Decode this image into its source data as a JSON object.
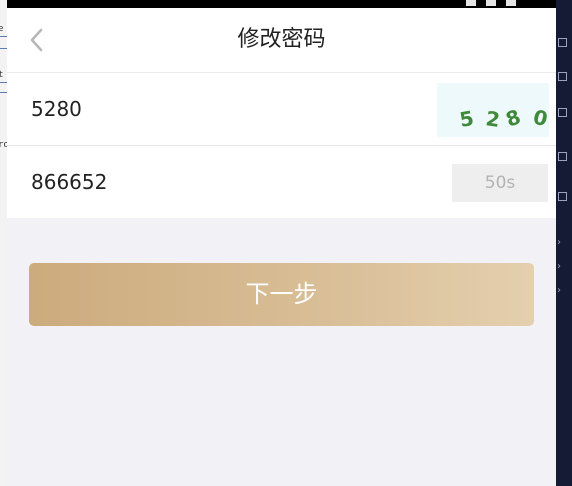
{
  "header": {
    "title": "修改密码",
    "back_icon": "chevron-left-icon"
  },
  "form": {
    "captcha_value": "5280",
    "captcha_image_text": "5280",
    "sms_code_value": "866652",
    "countdown_label": "50s"
  },
  "actions": {
    "next_label": "下一步"
  },
  "colors": {
    "button_gradient_start": "#ccab7d",
    "button_gradient_end": "#e4cfae",
    "page_background": "#f2f1f6",
    "captcha_glyph": "#3e8a3a"
  }
}
